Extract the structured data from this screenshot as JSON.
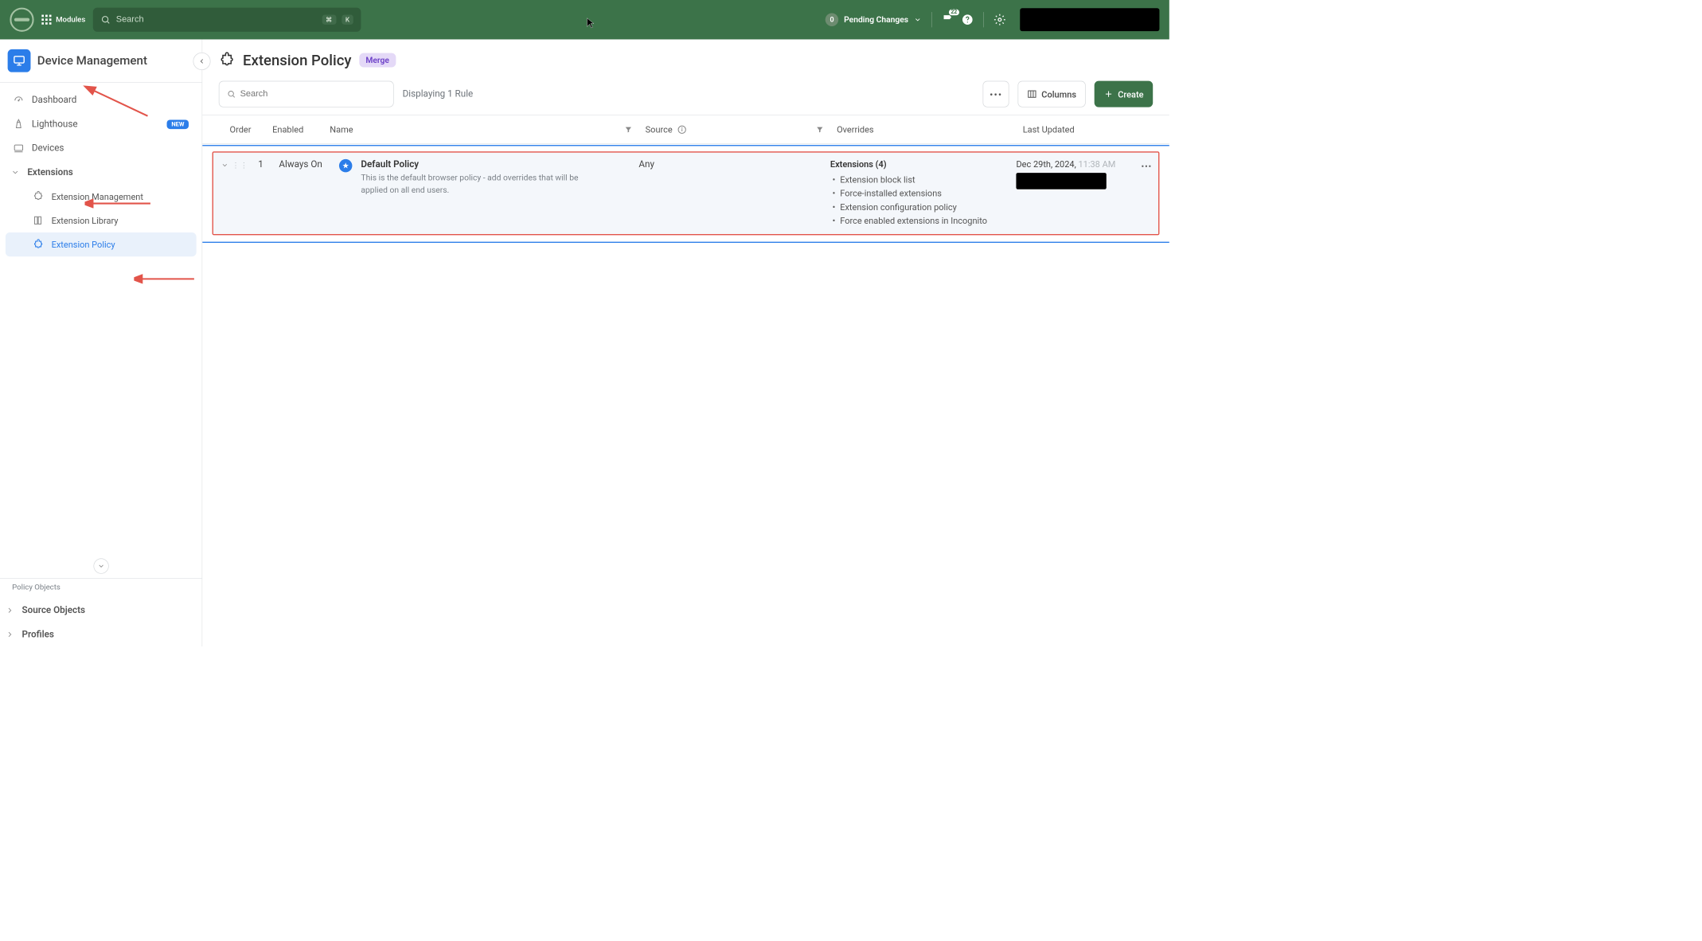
{
  "topbar": {
    "modules_label": "Modules",
    "search_placeholder": "Search",
    "kbd1": "⌘",
    "kbd2": "K",
    "pending_count": "0",
    "pending_label": "Pending Changes",
    "flag_badge": "22"
  },
  "sidebar": {
    "title": "Device Management",
    "items": {
      "dashboard": "Dashboard",
      "lighthouse": "Lighthouse",
      "lighthouse_badge": "NEW",
      "devices": "Devices",
      "extensions": "Extensions",
      "ext_mgmt": "Extension Management",
      "ext_lib": "Extension Library",
      "ext_policy": "Extension Policy"
    },
    "section_label": "Policy Objects",
    "source_objects": "Source Objects",
    "profiles": "Profiles"
  },
  "page": {
    "title": "Extension Policy",
    "merge_label": "Merge",
    "search_placeholder": "Search",
    "display_text": "Displaying 1 Rule",
    "columns_btn": "Columns",
    "create_btn": "Create"
  },
  "table": {
    "headers": {
      "order": "Order",
      "enabled": "Enabled",
      "name": "Name",
      "source": "Source",
      "overrides": "Overrides",
      "updated": "Last Updated"
    },
    "row": {
      "order": "1",
      "enabled": "Always On",
      "name": "Default Policy",
      "desc": "This is the default browser policy - add overrides that will be applied on all end users.",
      "source": "Any",
      "overrides_title": "Extensions (4)",
      "overrides": [
        "Extension block list",
        "Force-installed extensions",
        "Extension configuration policy",
        "Force enabled extensions in Incognito"
      ],
      "updated_date": "Dec 29th, 2024, ",
      "updated_time": "11:38 AM"
    }
  }
}
